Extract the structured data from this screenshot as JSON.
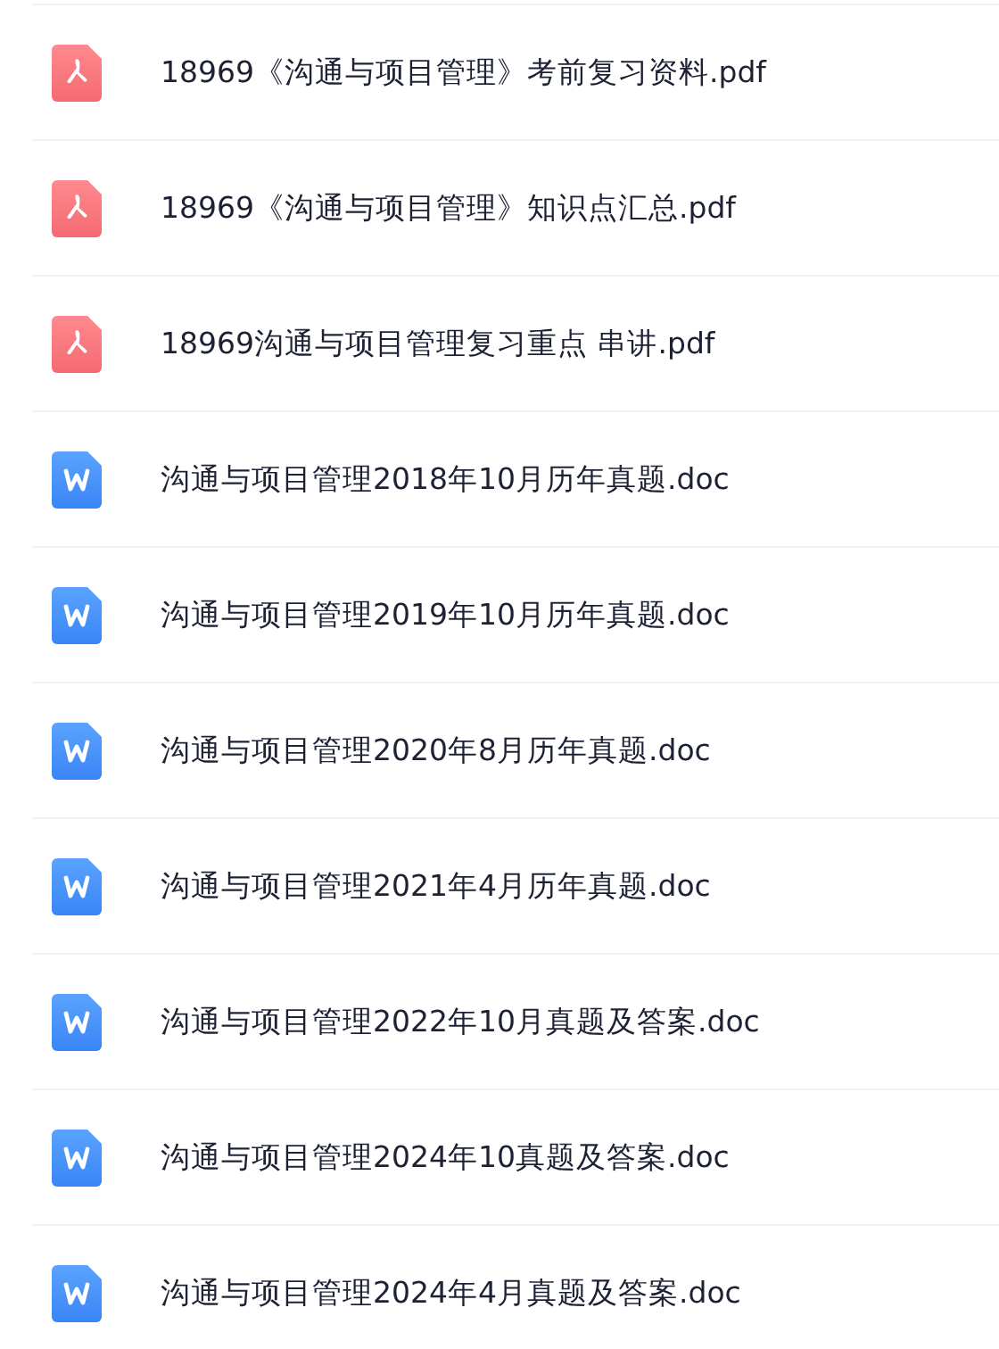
{
  "files": [
    {
      "kind": "pdf",
      "name": "18969《沟通与项目管理》考前复习资料.pdf"
    },
    {
      "kind": "pdf",
      "name": "18969《沟通与项目管理》知识点汇总.pdf"
    },
    {
      "kind": "pdf",
      "name": "18969沟通与项目管理复习重点 串讲.pdf"
    },
    {
      "kind": "doc",
      "name": "沟通与项目管理2018年10月历年真题.doc"
    },
    {
      "kind": "doc",
      "name": "沟通与项目管理2019年10月历年真题.doc"
    },
    {
      "kind": "doc",
      "name": "沟通与项目管理2020年8月历年真题.doc"
    },
    {
      "kind": "doc",
      "name": "沟通与项目管理2021年4月历年真题.doc"
    },
    {
      "kind": "doc",
      "name": "沟通与项目管理2022年10月真题及答案.doc"
    },
    {
      "kind": "doc",
      "name": "沟通与项目管理2024年10真题及答案.doc"
    },
    {
      "kind": "doc",
      "name": "沟通与项目管理2024年4月真题及答案.doc"
    }
  ]
}
